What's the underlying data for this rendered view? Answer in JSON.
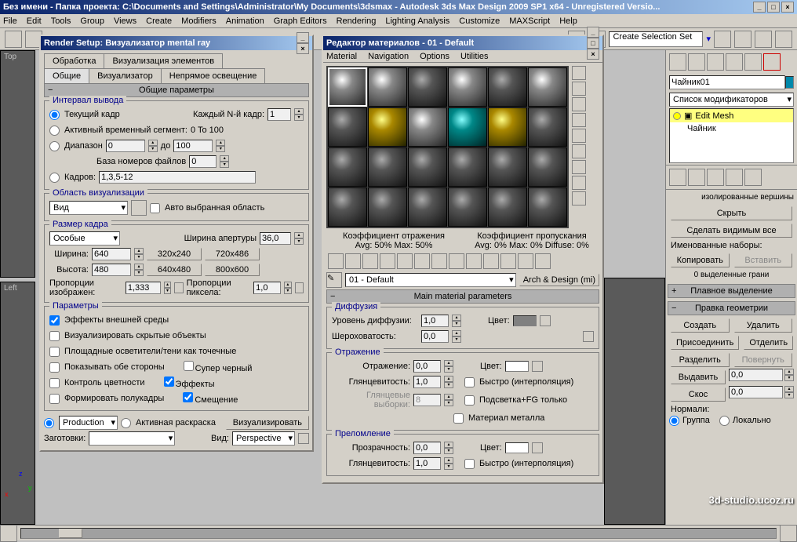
{
  "app": {
    "title": "Без имени     - Папка проекта: C:\\Documents and Settings\\Administrator\\My Documents\\3dsmax     - Autodesk 3ds Max Design 2009 SP1 x64 - Unregistered Versio..."
  },
  "menu": [
    "File",
    "Edit",
    "Tools",
    "Group",
    "Views",
    "Create",
    "Modifiers",
    "Animation",
    "Graph Editors",
    "Rendering",
    "Lighting Analysis",
    "Customize",
    "MAXScript",
    "Help"
  ],
  "toolbar": {
    "selection_set": "Create Selection Set"
  },
  "render_dlg": {
    "title": "Render Setup: Визуализатор mental ray",
    "tabs_row1": [
      "Обработка",
      "Визуализация элементов"
    ],
    "tabs_row2": [
      "Общие",
      "Визуализатор",
      "Непрямое освещение"
    ],
    "rollout1": "Общие параметры",
    "output_legend": "Интервал вывода",
    "opt_current": "Текущий кадр",
    "nth_label": "Каждый N-й кадр:",
    "nth_val": "1",
    "opt_active": "Активный временный сегмент:",
    "active_range": "0 To 100",
    "opt_range": "Диапазон",
    "range_from": "0",
    "range_to_label": "до",
    "range_to": "100",
    "file_base": "База номеров файлов",
    "file_base_val": "0",
    "opt_frames": "Кадров:",
    "frames_val": "1,3,5-12",
    "area_legend": "Область визуализации",
    "area_view": "Вид",
    "auto_region": "Авто выбранная область",
    "size_legend": "Размер кадра",
    "size_special": "Особые",
    "aperture_label": "Ширина апертуры",
    "aperture_val": "36,0",
    "width_label": "Ширина:",
    "width_val": "640",
    "height_label": "Высота:",
    "height_val": "480",
    "preset1": "320x240",
    "preset2": "720x486",
    "preset3": "640x480",
    "preset4": "800x600",
    "img_aspect_label": "Пропорции изображен:",
    "img_aspect_val": "1,333",
    "pix_aspect_label": "Пропорции пиксела:",
    "pix_aspect_val": "1,0",
    "params_legend": "Параметры",
    "chk_atmos": "Эффекты внешней среды",
    "chk_hidden": "Визуализировать скрытые объекты",
    "chk_area": "Площадные осветители/тени как точечные",
    "chk_2side": "Показывать обе стороны",
    "chk_super": "Супер черный",
    "chk_color": "Контроль цветности",
    "chk_effects": "Эффекты",
    "chk_fields": "Формировать полукадры",
    "chk_displace": "Смещение",
    "production": "Production",
    "active_shade": "Активная раскраска",
    "render_btn": "Визуализировать",
    "preset_label": "Заготовки:",
    "view_label": "Вид:",
    "view_val": "Perspective"
  },
  "mat_dlg": {
    "title": "Редактор материалов - 01 - Default",
    "menu": [
      "Material",
      "Navigation",
      "Options",
      "Utilities"
    ],
    "refl_label": "Коэффициент отражения",
    "refl_avg": "Avg: 50% Max: 50%",
    "trans_label": "Коэффициент пропускания",
    "trans_avg": "Avg: 0% Max: 0% Diffuse: 0%",
    "mat_name": "01 - Default",
    "mat_type": "Arch & Design (mi)",
    "rollout_main": "Main material parameters",
    "diffuse_legend": "Диффузия",
    "diff_level": "Уровень диффузии:",
    "diff_level_val": "1,0",
    "color_label": "Цвет:",
    "rough_label": "Шероховатость:",
    "rough_val": "0,0",
    "refl_legend": "Отражение",
    "refl_amt": "Отражение:",
    "refl_amt_val": "0,0",
    "gloss_label": "Глянцевитость:",
    "gloss_val": "1,0",
    "fast_interp": "Быстро (интерполяция)",
    "gloss_samples": "Глянцевые выборки:",
    "gloss_samples_val": "8",
    "highlights_fg": "Подсветка+FG только",
    "metal": "Материал металла",
    "refr_legend": "Преломление",
    "transp_label": "Прозрачность:",
    "transp_val": "0,0",
    "refr_gloss": "Глянцевитость:",
    "refr_gloss_val": "1,0"
  },
  "right": {
    "obj_name": "Чайник01",
    "mod_list_label": "Список модификаторов",
    "mod1": "Edit Mesh",
    "mod2": "Чайник",
    "iso_verts": "изолированные вершины",
    "hide": "Скрыть",
    "unhide": "Сделать видимым все",
    "named_sel": "Именованные наборы:",
    "copy": "Копировать",
    "paste": "Вставить",
    "sel_faces": "0 выделенные грани",
    "soft_sel": "Плавное выделение",
    "edit_geom": "Правка геометрии",
    "create": "Создать",
    "delete": "Удалить",
    "attach": "Присоединить",
    "detach": "Отделить",
    "divide": "Разделить",
    "turn": "Повернуть",
    "extrude": "Выдавить",
    "extrude_val": "0,0",
    "bevel": "Скос",
    "bevel_val": "0,0",
    "normals": "Нормали:",
    "group": "Группа",
    "local": "Локально"
  },
  "viewports": {
    "top": "Top",
    "left": "Left"
  },
  "watermark": "3d-studio.ucoz.ru"
}
